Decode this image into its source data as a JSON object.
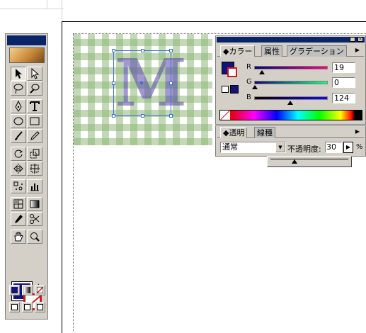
{
  "color_panel": {
    "tabs": [
      "カラー",
      "属性",
      "グラデーション"
    ],
    "channels": [
      {
        "label": "R",
        "value": "19",
        "fraction": 0.07
      },
      {
        "label": "G",
        "value": "0",
        "fraction": 0.0
      },
      {
        "label": "B",
        "value": "124",
        "fraction": 0.49
      }
    ],
    "fill_color": "#131378",
    "stroke_color": "#c41e1e"
  },
  "transparency_panel": {
    "tabs": [
      "透明",
      "線種"
    ],
    "blend_mode": "通常",
    "opacity_label": "不透明度:",
    "opacity_value": "30",
    "opacity_unit": "%"
  },
  "artwork": {
    "letter": "M",
    "letter_opacity": 0.3,
    "pattern": "green gingham"
  },
  "toolbox": {
    "fill_color": "#131378",
    "stroke_color": "#c41e1e",
    "tools": [
      "selection",
      "direct-selection",
      "lasso",
      "magic-wand",
      "pen",
      "type",
      "ellipse",
      "rectangle",
      "paintbrush",
      "pencil",
      "rotate",
      "scale",
      "reflect",
      "free-transform",
      "symbol-sprayer",
      "column-graph",
      "mesh",
      "gradient",
      "eyedropper",
      "scissors",
      "hand",
      "zoom"
    ]
  }
}
